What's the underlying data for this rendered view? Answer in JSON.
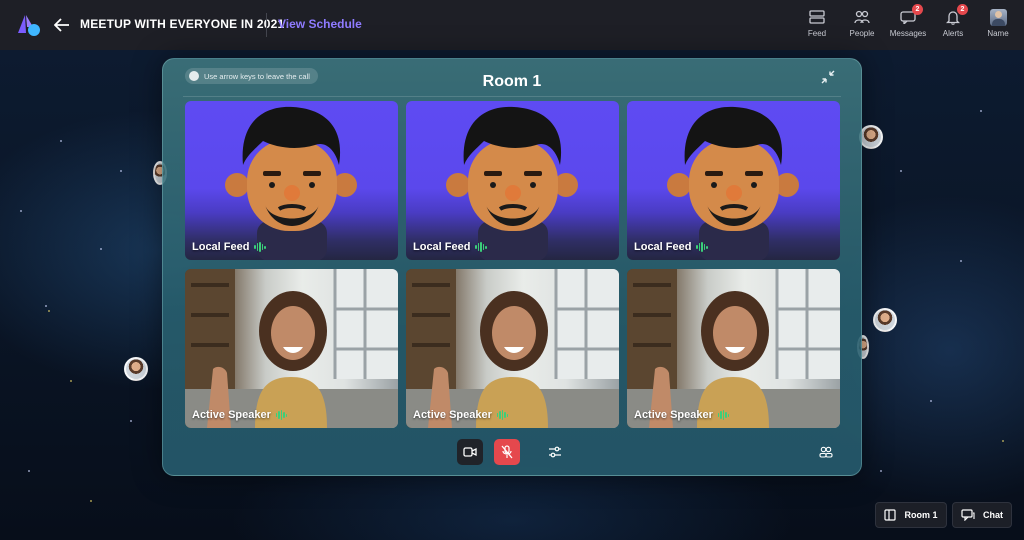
{
  "header": {
    "event_title": "MEETUP WITH EVERYONE IN 2021",
    "view_schedule": "View Schedule",
    "nav": [
      {
        "label": "Feed",
        "icon": "feed-icon"
      },
      {
        "label": "People",
        "icon": "people-icon"
      },
      {
        "label": "Messages",
        "icon": "messages-icon",
        "badge": "2"
      },
      {
        "label": "Alerts",
        "icon": "bell-icon",
        "badge": "2"
      },
      {
        "label": "Name",
        "icon": "user-avatar"
      }
    ]
  },
  "room": {
    "hint": "Use arrow keys to leave the call",
    "title": "Room 1",
    "tiles": [
      {
        "label": "Local Feed",
        "kind": "avatar"
      },
      {
        "label": "Local Feed",
        "kind": "avatar"
      },
      {
        "label": "Local Feed",
        "kind": "avatar"
      },
      {
        "label": "Active Speaker",
        "kind": "speaker"
      },
      {
        "label": "Active Speaker",
        "kind": "speaker"
      },
      {
        "label": "Active Speaker",
        "kind": "speaker"
      }
    ],
    "controls": [
      "camera-icon",
      "mic-muted-icon",
      "settings-sliders-icon",
      "participants-icon"
    ]
  },
  "footer": {
    "room_button": "Room 1",
    "chat_button": "Chat"
  },
  "colors": {
    "accent": "#8f7bff",
    "badge": "#e5484d",
    "mic_muted": "#e5484d",
    "speaking": "#3ad07a",
    "avatar_bg": "#5e4bf3"
  }
}
